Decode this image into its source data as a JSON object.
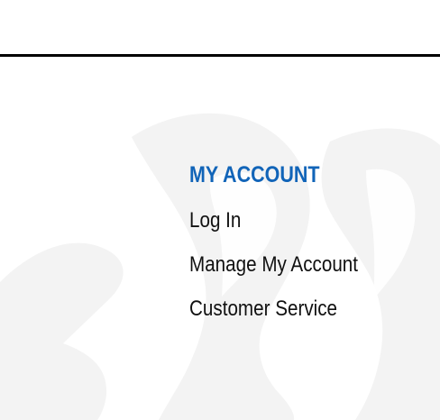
{
  "colors": {
    "accent": "#1164b8",
    "text": "#111111",
    "rule": "#000000",
    "watermark": "#f3f3f3",
    "background": "#ffffff"
  },
  "account_menu": {
    "heading": "MY ACCOUNT",
    "items": [
      {
        "label": "Log In"
      },
      {
        "label": "Manage My Account"
      },
      {
        "label": "Customer Service"
      }
    ]
  },
  "watermark": {
    "icon": "gothic-letter-watermark-icon"
  }
}
